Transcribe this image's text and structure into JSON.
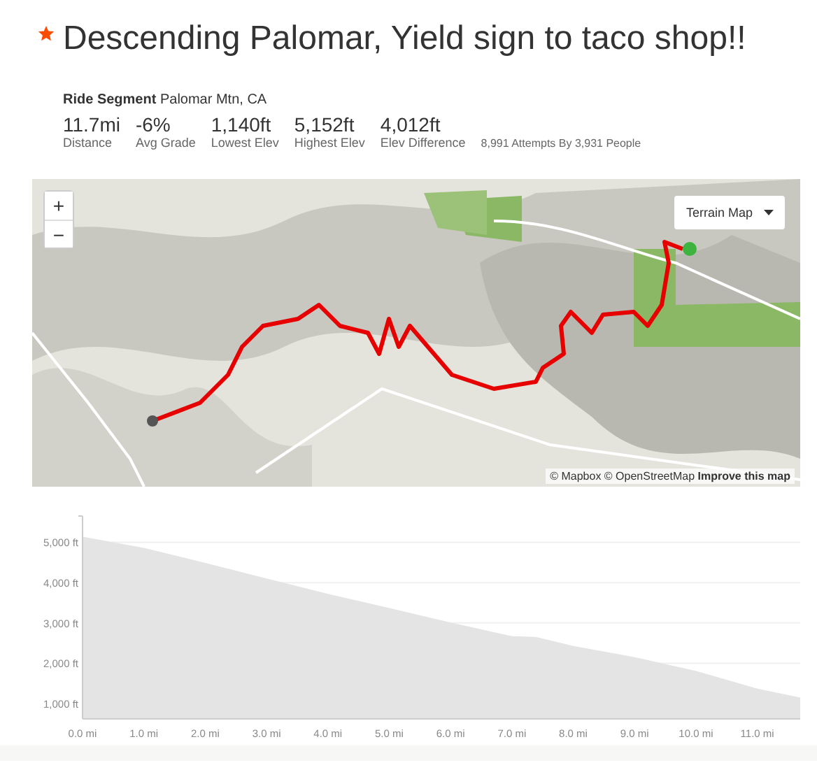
{
  "title": "Descending Palomar, Yield sign to taco shop!!",
  "starred": true,
  "segment": {
    "line": "**Ride Segment** Palomar Mtn, CA",
    "stats": [
      {
        "value": "11.7mi",
        "label": "Distance"
      },
      {
        "value": "-6%",
        "label": "Avg Grade"
      },
      {
        "value": "1,140ft",
        "label": "Lowest Elev"
      },
      {
        "value": "5,152ft",
        "label": "Highest Elev"
      },
      {
        "value": "4,012ft",
        "label": "Elev Difference"
      }
    ],
    "attempts": "8,991 Attempts By 3,931 People"
  },
  "map": {
    "kind": "picture",
    "zoom_in": "+",
    "zoom_out": "−",
    "layer_button": "Terrain Map",
    "attribution": "© Mapbox © OpenStreetMap **Improve this map**"
  },
  "elevation": {
    "chart_data": {
      "type": "area",
      "x": [
        0,
        1,
        2,
        3,
        4,
        5,
        6,
        7,
        7.4,
        8,
        9,
        10,
        11,
        11.7
      ],
      "grid": true,
      "series": [
        {
          "color": "#e4e4e4",
          "values": [
            5140,
            4860,
            4490,
            4100,
            3720,
            3370,
            3010,
            2670,
            2650,
            2430,
            2150,
            1810,
            1370,
            1150
          ]
        }
      ],
      "xlim": [
        0,
        11.7
      ],
      "ylim": [
        620,
        5650
      ],
      "xticks": [
        {
          "value": 0,
          "label": "0.0 mi"
        },
        {
          "value": 1,
          "label": "1.0 mi"
        },
        {
          "value": 2,
          "label": "2.0 mi"
        },
        {
          "value": 3,
          "label": "3.0 mi"
        },
        {
          "value": 4,
          "label": "4.0 mi"
        },
        {
          "value": 5,
          "label": "5.0 mi"
        },
        {
          "value": 6,
          "label": "6.0 mi"
        },
        {
          "value": 7,
          "label": "7.0 mi"
        },
        {
          "value": 8,
          "label": "8.0 mi"
        },
        {
          "value": 9,
          "label": "9.0 mi"
        },
        {
          "value": 10,
          "label": "10.0 mi"
        },
        {
          "value": 11,
          "label": "11.0 mi"
        }
      ],
      "yticks": [
        {
          "value": 1000,
          "label": "1,000 ft"
        },
        {
          "value": 2000,
          "label": "2,000 ft"
        },
        {
          "value": 3000,
          "label": "3,000 ft"
        },
        {
          "value": 4000,
          "label": "4,000 ft"
        },
        {
          "value": 5000,
          "label": "5,000 ft"
        }
      ]
    }
  }
}
